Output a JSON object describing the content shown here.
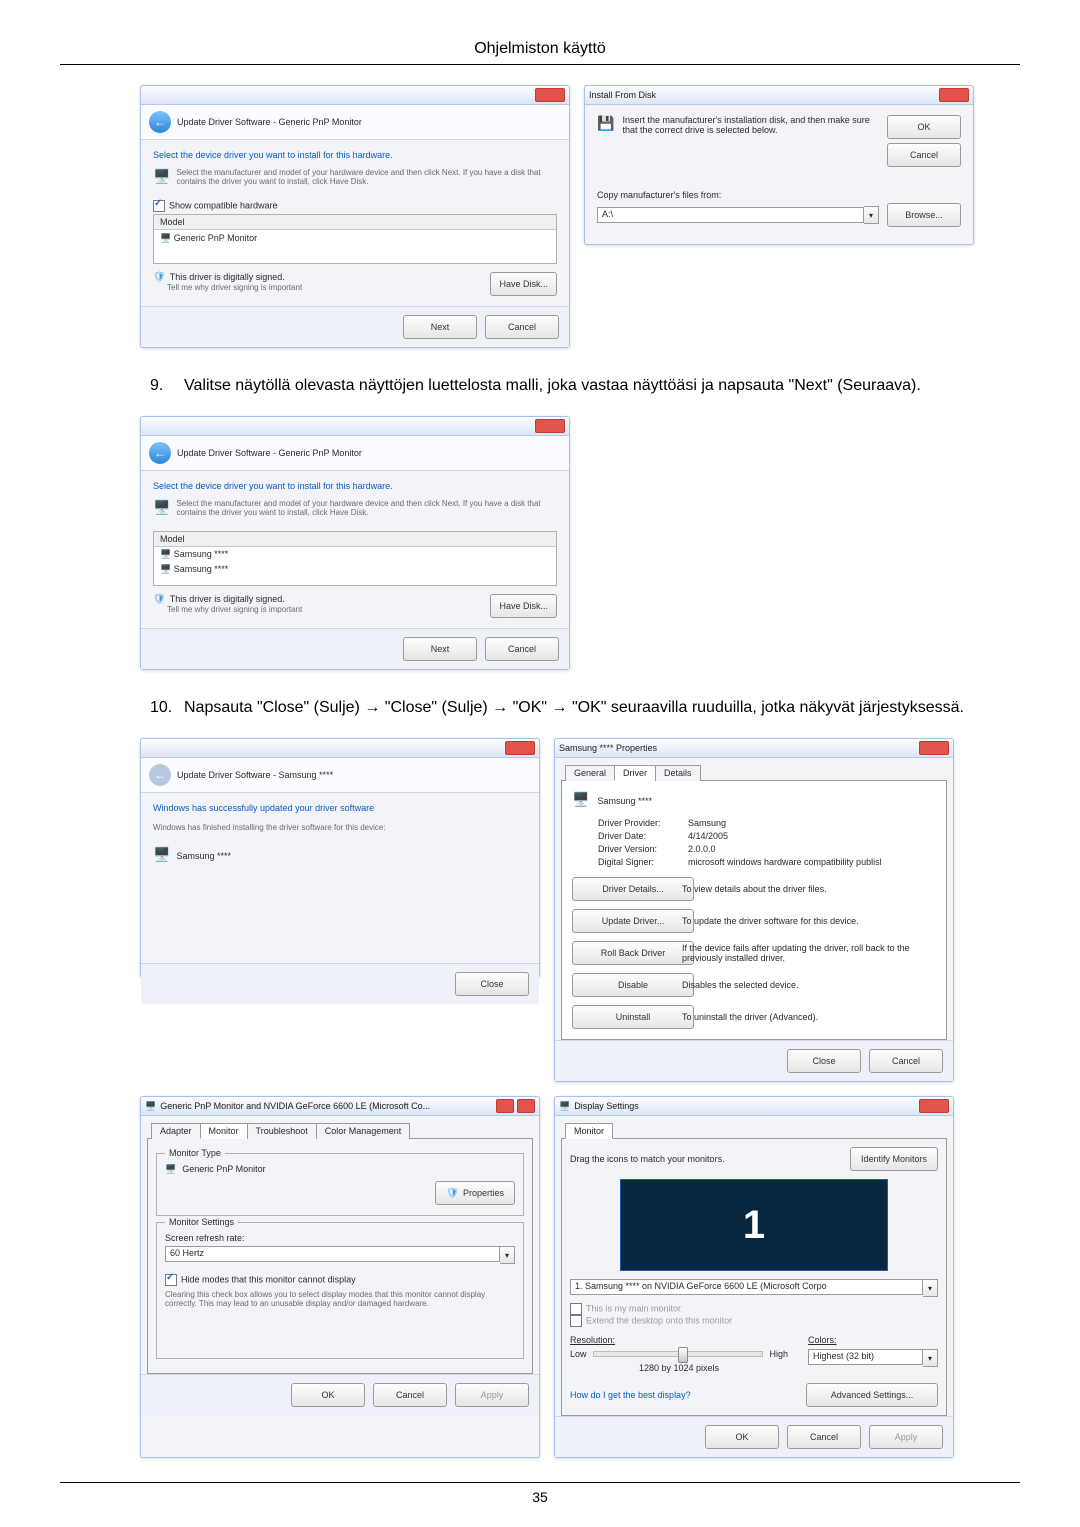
{
  "page": {
    "header": "Ohjelmiston käyttö",
    "number": "35"
  },
  "step9": {
    "num": "9.",
    "text": "Valitse näytöllä olevasta näyttöjen luettelosta malli, joka vastaa näyttöäsi ja napsauta \"Next\" (Seuraava)."
  },
  "step10": {
    "num": "10.",
    "text": "Napsauta \"Close\" (Sulje) → \"Close\" (Sulje) → \"OK\" → \"OK\" seuraavilla ruuduilla, jotka näkyvät järjestyksessä."
  },
  "dlg_update1": {
    "breadcrumb": "Update Driver Software - Generic PnP Monitor",
    "heading": "Select the device driver you want to install for this hardware.",
    "desc": "Select the manufacturer and model of your hardware device and then click Next. If you have a disk that contains the driver you want to install, click Have Disk.",
    "show_compat": "Show compatible hardware",
    "model_label": "Model",
    "model_item": "Generic PnP Monitor",
    "signed": "This driver is digitally signed.",
    "tell_why": "Tell me why driver signing is important",
    "have_disk": "Have Disk...",
    "next": "Next",
    "cancel": "Cancel"
  },
  "dlg_installdisk": {
    "title": "Install From Disk",
    "desc": "Insert the manufacturer's installation disk, and then make sure that the correct drive is selected below.",
    "ok": "OK",
    "cancel": "Cancel",
    "copy_label": "Copy manufacturer's files from:",
    "drive": "A:\\",
    "browse": "Browse..."
  },
  "dlg_update2": {
    "breadcrumb": "Update Driver Software - Generic PnP Monitor",
    "heading": "Select the device driver you want to install for this hardware.",
    "desc": "Select the manufacturer and model of your hardware device and then click Next. If you have a disk that contains the driver you want to install, click Have Disk.",
    "model_label": "Model",
    "model_item1": "Samsung ****",
    "model_item2": "Samsung ****",
    "signed": "This driver is digitally signed.",
    "tell_why": "Tell me why driver signing is important",
    "have_disk": "Have Disk...",
    "next": "Next",
    "cancel": "Cancel"
  },
  "dlg_success": {
    "breadcrumb": "Update Driver Software - Samsung ****",
    "heading": "Windows has successfully updated your driver software",
    "desc": "Windows has finished installing the driver software for this device:",
    "device": "Samsung ****",
    "close": "Close"
  },
  "dlg_props": {
    "title": "Samsung **** Properties",
    "tab_general": "General",
    "tab_driver": "Driver",
    "tab_details": "Details",
    "device": "Samsung ****",
    "provider_label": "Driver Provider:",
    "provider": "Samsung",
    "date_label": "Driver Date:",
    "date": "4/14/2005",
    "version_label": "Driver Version:",
    "version": "2.0.0.0",
    "signer_label": "Digital Signer:",
    "signer": "microsoft windows hardware compatibility publisl",
    "btn_details": "Driver Details...",
    "btn_details_desc": "To view details about the driver files.",
    "btn_update": "Update Driver...",
    "btn_update_desc": "To update the driver software for this device.",
    "btn_rollback": "Roll Back Driver",
    "btn_rollback_desc": "If the device fails after updating the driver, roll back to the previously installed driver.",
    "btn_disable": "Disable",
    "btn_disable_desc": "Disables the selected device.",
    "btn_uninstall": "Uninstall",
    "btn_uninstall_desc": "To uninstall the driver (Advanced).",
    "close": "Close",
    "cancel": "Cancel"
  },
  "dlg_monitor": {
    "title": "Generic PnP Monitor and NVIDIA GeForce 6600 LE (Microsoft Co...",
    "tab_adapter": "Adapter",
    "tab_monitor": "Monitor",
    "tab_troubleshoot": "Troubleshoot",
    "tab_color": "Color Management",
    "group_type": "Monitor Type",
    "type_name": "Generic PnP Monitor",
    "properties": "Properties",
    "group_settings": "Monitor Settings",
    "refresh_label": "Screen refresh rate:",
    "refresh_value": "60 Hertz",
    "hide_modes": "Hide modes that this monitor cannot display",
    "hide_desc": "Clearing this check box allows you to select display modes that this monitor cannot display correctly. This may lead to an unusable display and/or damaged hardware.",
    "ok": "OK",
    "cancel": "Cancel",
    "apply": "Apply"
  },
  "dlg_display": {
    "title": "Display Settings",
    "tab_monitor": "Monitor",
    "drag_text": "Drag the icons to match your monitors.",
    "identify": "Identify Monitors",
    "monitor_num": "1",
    "select_value": "1. Samsung **** on NVIDIA GeForce 6600 LE (Microsoft Corpo",
    "this_main": "This is my main monitor",
    "extend": "Extend the desktop onto this monitor",
    "resolution_label": "Resolution:",
    "low": "Low",
    "high": "High",
    "res_value": "1280 by 1024 pixels",
    "colors_label": "Colors:",
    "colors_value": "Highest (32 bit)",
    "best_display": "How do I get the best display?",
    "advanced": "Advanced Settings...",
    "ok": "OK",
    "cancel": "Cancel",
    "apply": "Apply"
  }
}
